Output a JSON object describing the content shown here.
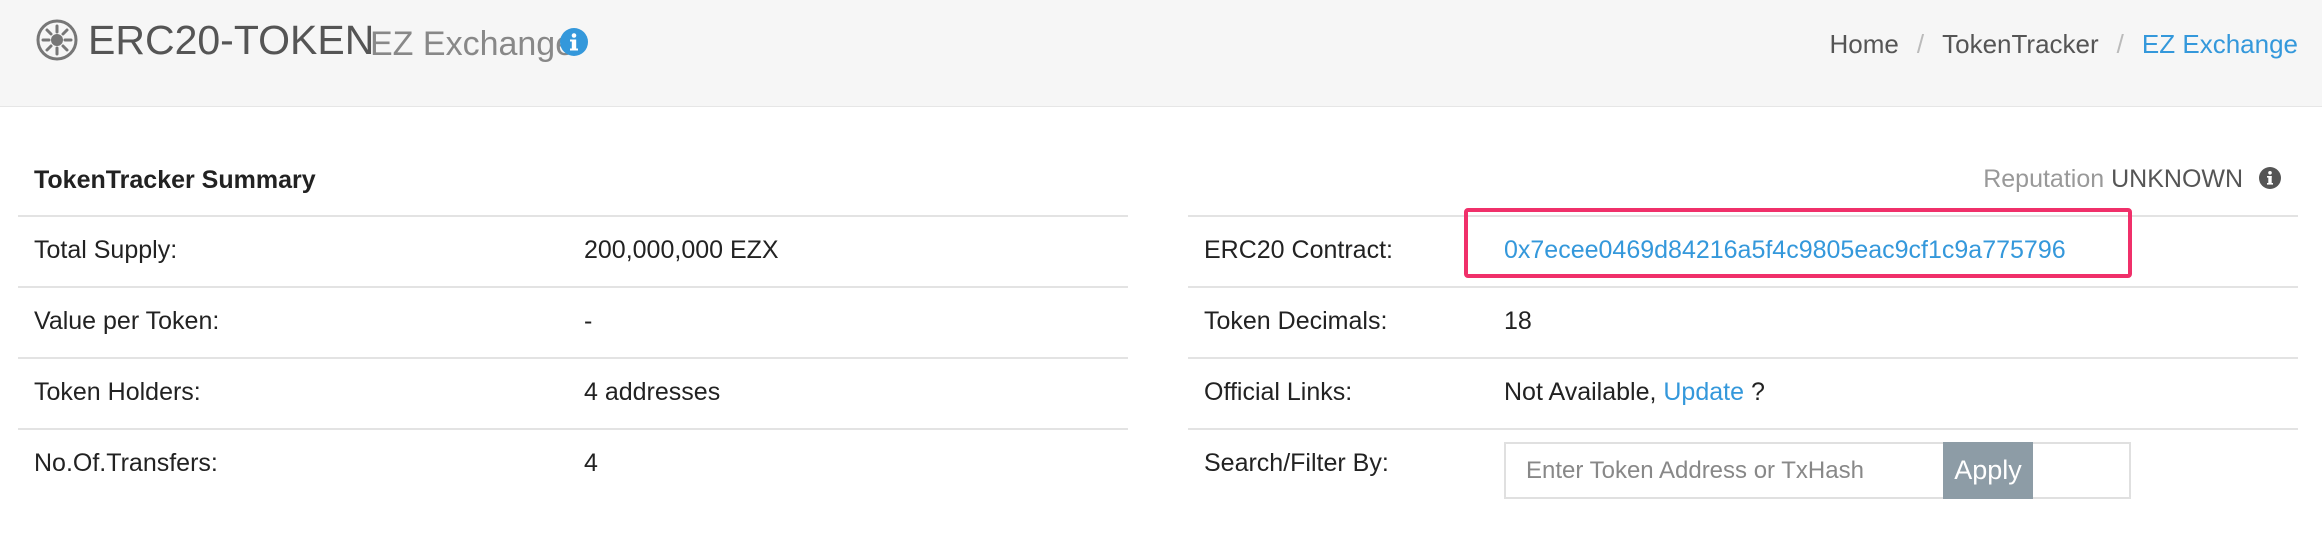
{
  "colors": {
    "accent": "#3498db",
    "highlight": "#f0306a",
    "apply_button": "#8d9ca6"
  },
  "header": {
    "logo_icon": "ethereum-gear-icon",
    "title": "ERC20-TOKEN",
    "subtitle": "EZ Exchange",
    "subtitle_info_icon": "info-circle-icon"
  },
  "breadcrumb": {
    "items": [
      "Home",
      "TokenTracker",
      "EZ Exchange"
    ],
    "separator": "/"
  },
  "summary": {
    "title": "TokenTracker Summary",
    "reputation_label": "Reputation",
    "reputation_value": "UNKNOWN",
    "reputation_icon": "info-circle-icon"
  },
  "left_table": [
    {
      "label": "Total Supply:",
      "value": "200,000,000 EZX"
    },
    {
      "label": "Value per Token:",
      "value": "-"
    },
    {
      "label": "Token Holders:",
      "value": "4 addresses"
    },
    {
      "label": "No.Of.Transfers:",
      "value": "4"
    }
  ],
  "right_table": {
    "contract_label": "ERC20 Contract:",
    "contract_address": "0x7ecee0469d84216a5f4c9805eac9cf1c9a775796",
    "decimals_label": "Token Decimals:",
    "decimals_value": "18",
    "links_label": "Official Links:",
    "links_not_available": "Not Available,",
    "links_update": "Update",
    "links_question": "?",
    "search_label": "Search/Filter By:",
    "search_placeholder": "Enter Token Address or TxHash",
    "apply_label": "Apply"
  }
}
